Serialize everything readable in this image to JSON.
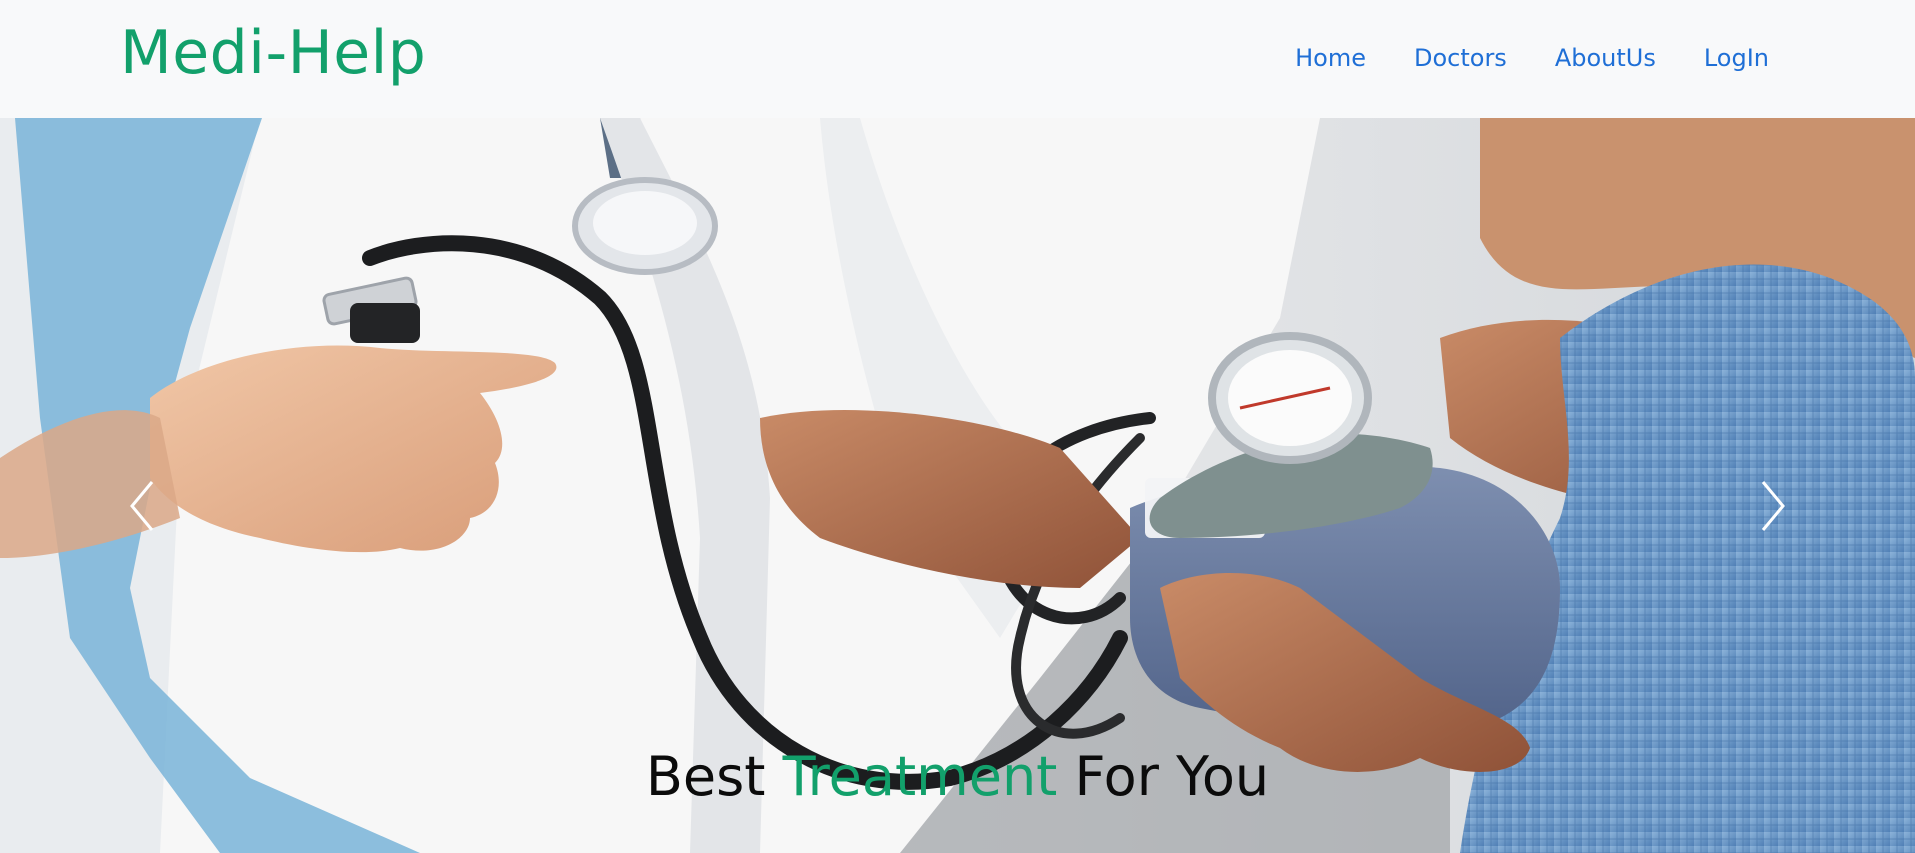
{
  "header": {
    "brand": "Medi-Help",
    "nav": [
      {
        "label": "Home"
      },
      {
        "label": "Doctors"
      },
      {
        "label": "AboutUs"
      },
      {
        "label": "LogIn"
      }
    ]
  },
  "hero": {
    "image_alt_icon": "blood-pressure-measurement-photo",
    "caption": {
      "part1": "Best",
      "part2": "Treatment",
      "part3": "For You"
    },
    "controls": {
      "prev_icon": "chevron-left-icon",
      "next_icon": "chevron-right-icon"
    }
  },
  "colors": {
    "brand": "#12a06b",
    "nav_link": "#1f6fd6",
    "navbar_bg": "#f8f9fa"
  }
}
